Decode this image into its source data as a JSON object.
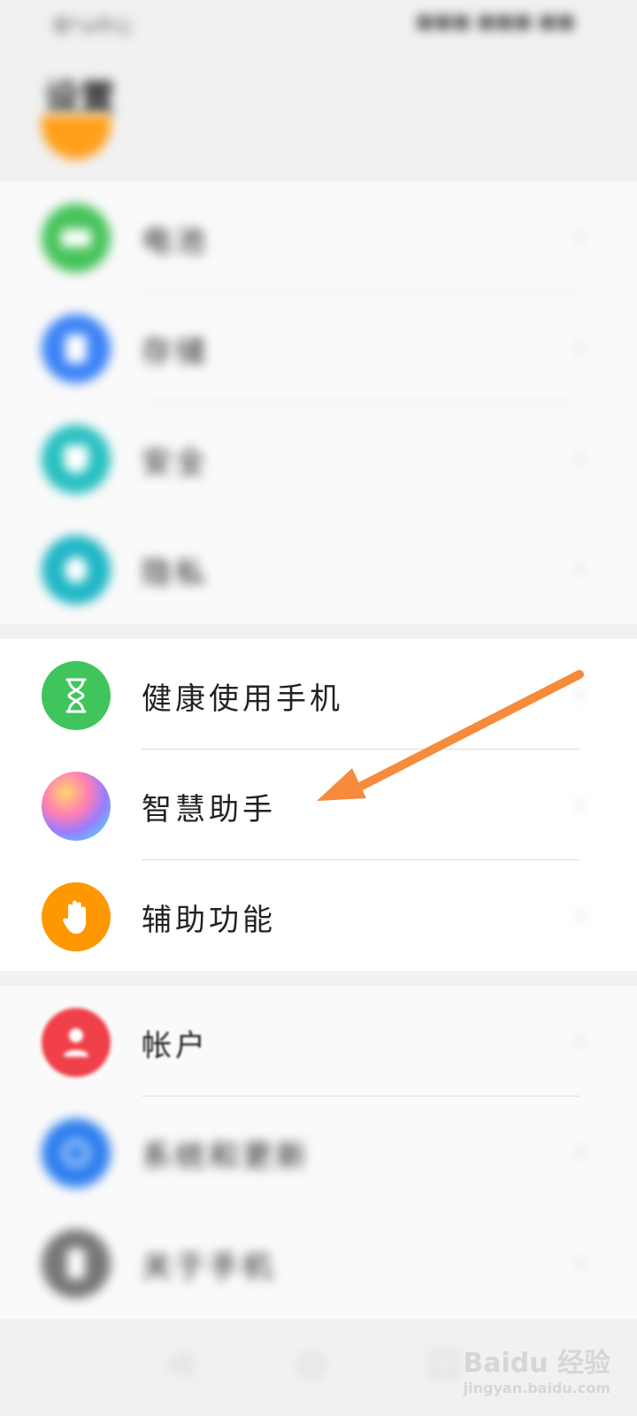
{
  "status_bar": {
    "left": "新*a中心",
    "right": "■■■ ■■■ ■■"
  },
  "title": "设置",
  "blurred_items": [
    {
      "label": "电池",
      "color": "#46c35a"
    },
    {
      "label": "存储",
      "color": "#3b82f6"
    },
    {
      "label": "安全",
      "color": "#26bfbf"
    },
    {
      "label": "隐私",
      "color": "#1fb6c6"
    }
  ],
  "items": {
    "health": {
      "label": "健康使用手机",
      "color": "#3fc55c"
    },
    "assistant": {
      "label": "智慧助手"
    },
    "accessibility": {
      "label": "辅助功能",
      "color": "#ff9800"
    },
    "account": {
      "label": "帐户",
      "color": "#f0404a"
    },
    "system": {
      "label": "系统和更新",
      "color": "#2d7ff0"
    },
    "about": {
      "label": "关于手机",
      "color": "#777777"
    }
  },
  "chevron": "›",
  "arrow_color": "#f68b3b",
  "watermark": {
    "main": "Baidu 经验",
    "sub": "jingyan.baidu.com"
  }
}
